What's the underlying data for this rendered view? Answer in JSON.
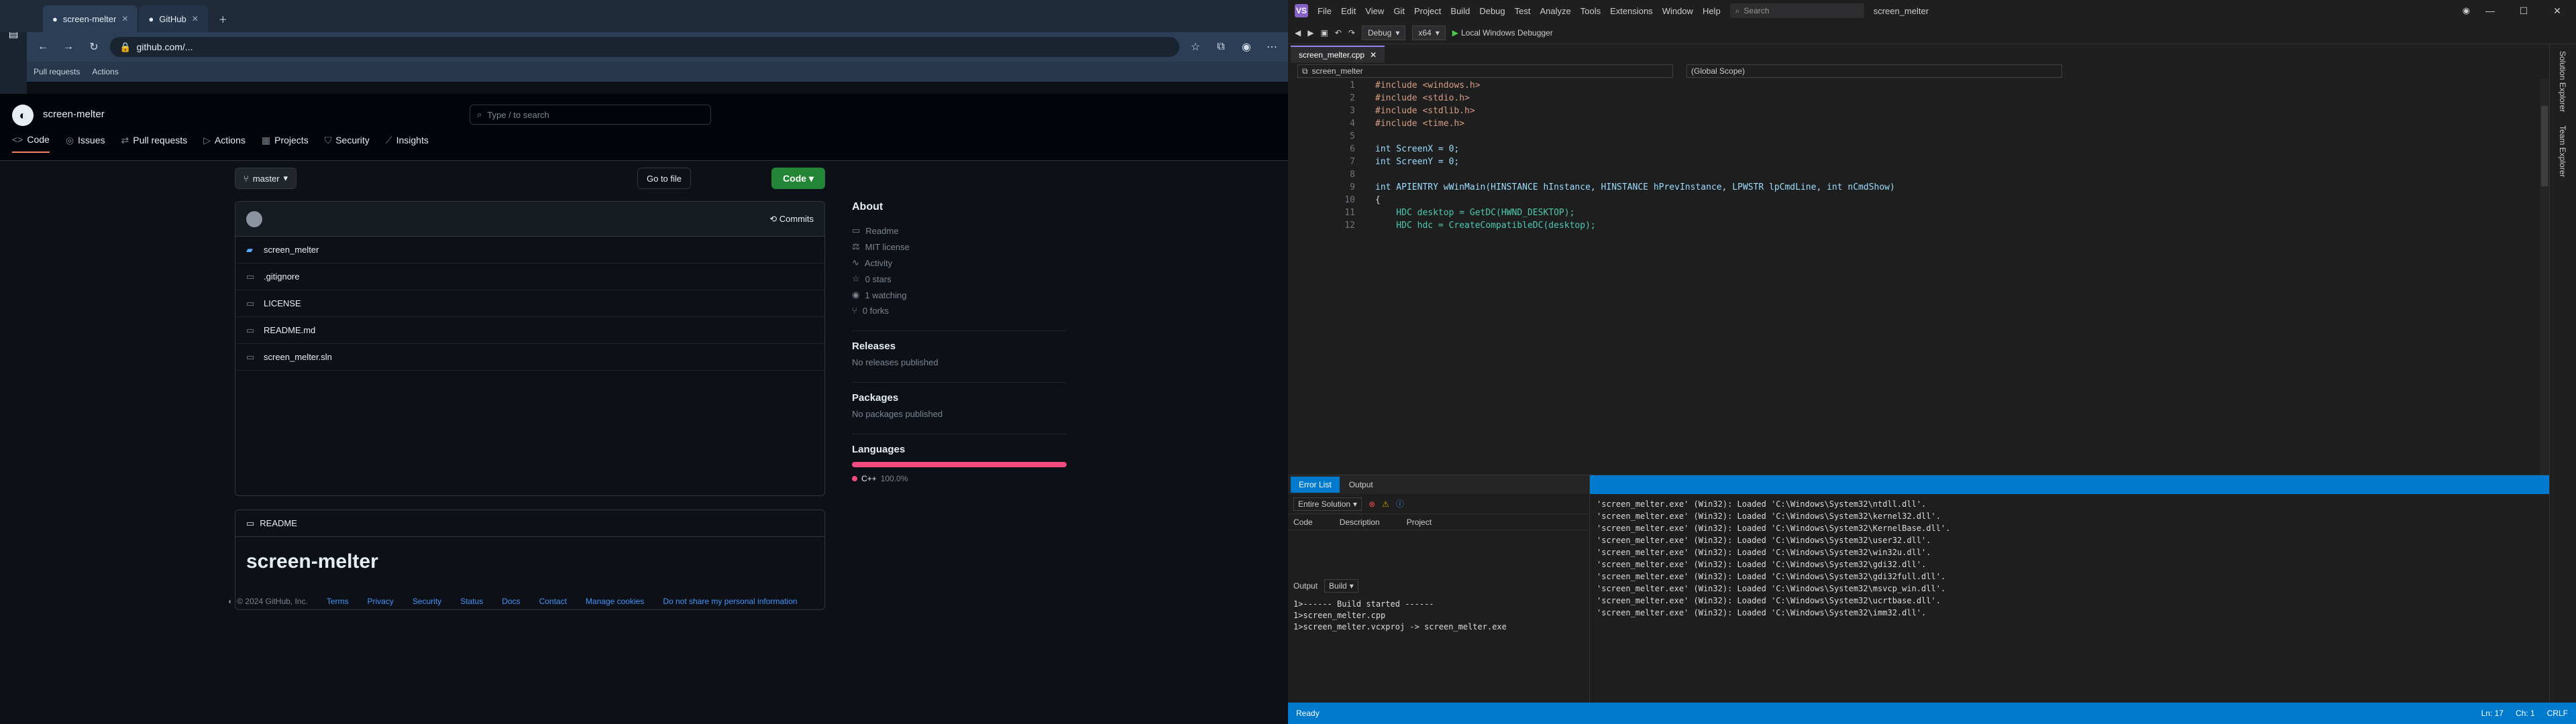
{
  "left": {
    "browser": {
      "tabs": [
        {
          "label": "screen-melter",
          "active": true
        },
        {
          "label": "GitHub"
        }
      ],
      "url": "github.com/...",
      "bookmarks": [
        "Pull requests",
        "Actions"
      ]
    },
    "github": {
      "owner": "",
      "repo": "screen-melter",
      "search_placeholder": "Type / to search",
      "nav": [
        "Code",
        "Issues",
        "Pull requests",
        "Actions",
        "Projects",
        "Security",
        "Insights"
      ],
      "branch": "master",
      "goto_label": "Go to file",
      "code_label": "Code",
      "commits_label": "Commits",
      "files": [
        {
          "name": "screen_melter",
          "dir": true,
          "msg": "",
          "time": ""
        },
        {
          "name": ".gitignore",
          "dir": false,
          "msg": "",
          "time": ""
        },
        {
          "name": "LICENSE",
          "dir": false,
          "msg": "",
          "time": ""
        },
        {
          "name": "README.md",
          "dir": false,
          "msg": "",
          "time": ""
        },
        {
          "name": "screen_melter.sln",
          "dir": false,
          "msg": "",
          "time": ""
        }
      ],
      "readme_tab": "README",
      "readme_title": "screen-melter",
      "about": {
        "heading": "About",
        "desc": "",
        "readme": "Readme",
        "license": "MIT license",
        "activity": "Activity",
        "stars": "0 stars",
        "watching": "1 watching",
        "forks": "0 forks",
        "releases_heading": "Releases",
        "releases_text": "No releases published",
        "packages_heading": "Packages",
        "packages_text": "No packages published",
        "languages_heading": "Languages",
        "lang_name": "C++",
        "lang_pct": "100.0%",
        "lang_color": "#f34b7d"
      },
      "footer": {
        "copyright": "© 2024 GitHub, Inc.",
        "links": [
          "Terms",
          "Privacy",
          "Security",
          "Status",
          "Docs",
          "Contact",
          "Manage cookies",
          "Do not share my personal information"
        ]
      }
    }
  },
  "right": {
    "vs": {
      "menus": [
        "File",
        "Edit",
        "View",
        "Git",
        "Project",
        "Build",
        "Debug",
        "Test",
        "Analyze",
        "Tools",
        "Extensions",
        "Window",
        "Help"
      ],
      "search_label": "Search",
      "solution_name": "screen_melter",
      "config": "Debug",
      "platform": "x64",
      "run_label": "Local Windows Debugger",
      "doc_tab": "screen_melter.cpp",
      "nav_scope": "screen_melter",
      "nav_member": "(Global Scope)",
      "code": [
        "#include <windows.h>",
        "#include <stdio.h>",
        "#include <stdlib.h>",
        "#include <time.h>",
        "",
        "int ScreenX = 0;",
        "int ScreenY = 0;",
        "",
        "int APIENTRY wWinMain(HINSTANCE hInstance, HINSTANCE hPrevInstance, LPWSTR lpCmdLine, int nCmdShow)",
        "{",
        "    HDC desktop = GetDC(HWND_DESKTOP);",
        "    HDC hdc = CreateCompatibleDC(desktop);"
      ],
      "output_tabs": [
        "Error List",
        "Output"
      ],
      "errlist_scope": "Entire Solution",
      "errlist_cols": [
        "Code",
        "Description",
        "Project"
      ],
      "output_label": "Output",
      "output_source": "Build",
      "output_lines": [
        "1>------ Build started ------",
        "1>screen_melter.cpp",
        "1>screen_melter.vcxproj -> screen_melter.exe"
      ],
      "debug_lines": [
        "'screen_melter.exe' (Win32): Loaded 'C:\\Windows\\System32\\ntdll.dll'.",
        "'screen_melter.exe' (Win32): Loaded 'C:\\Windows\\System32\\kernel32.dll'.",
        "'screen_melter.exe' (Win32): Loaded 'C:\\Windows\\System32\\KernelBase.dll'.",
        "'screen_melter.exe' (Win32): Loaded 'C:\\Windows\\System32\\user32.dll'.",
        "'screen_melter.exe' (Win32): Loaded 'C:\\Windows\\System32\\win32u.dll'.",
        "'screen_melter.exe' (Win32): Loaded 'C:\\Windows\\System32\\gdi32.dll'.",
        "'screen_melter.exe' (Win32): Loaded 'C:\\Windows\\System32\\gdi32full.dll'.",
        "'screen_melter.exe' (Win32): Loaded 'C:\\Windows\\System32\\msvcp_win.dll'.",
        "'screen_melter.exe' (Win32): Loaded 'C:\\Windows\\System32\\ucrtbase.dll'.",
        "'screen_melter.exe' (Win32): Loaded 'C:\\Windows\\System32\\imm32.dll'."
      ],
      "side_tabs": [
        "Solution Explorer",
        "Team Explorer"
      ],
      "status_left": "Ready",
      "status_right": [
        "Ln: 17",
        "Ch: 1",
        "CRLF"
      ]
    }
  }
}
